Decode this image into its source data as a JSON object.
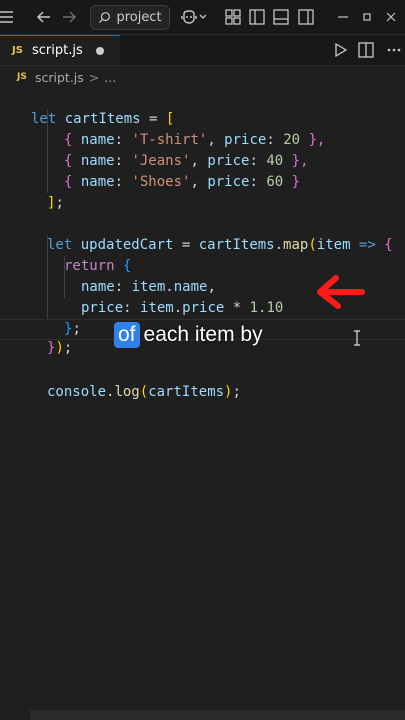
{
  "titlebar": {
    "search_text": "project"
  },
  "tab": {
    "badge": "JS",
    "filename": "script.js"
  },
  "breadcrumb": {
    "badge": "JS",
    "file": "script.js",
    "separator": ">",
    "more": "..."
  },
  "caption": {
    "highlight": "of",
    "rest": "each item by"
  },
  "colors": {
    "accent": "#0078d4",
    "arrow": "#ff1a1a",
    "caption_highlight": "#2f82ea"
  },
  "code": {
    "l1_let": "let",
    "l1_name": "cartItems",
    "l1_eq": " = ",
    "l1_br": "[",
    "items": [
      {
        "open": "{",
        "k1": "name",
        "v1": "'T-shirt'",
        "k2": "price",
        "v2": "20",
        "close": "},"
      },
      {
        "open": "{",
        "k1": "name",
        "v1": "'Jeans'",
        "k2": "price",
        "v2": "40",
        "close": "},"
      },
      {
        "open": "{",
        "k1": "name",
        "v1": "'Shoes'",
        "k2": "price",
        "v2": "60",
        "close": "}"
      }
    ],
    "l5_br": "]",
    "l5_semi": ";",
    "l7_let": "let",
    "l7_name": "updatedCart",
    "l7_eq": " = ",
    "l7_obj": "cartItems",
    "l7_dot": ".",
    "l7_fn": "map",
    "l7_paren": "(",
    "l7_param": "item",
    "l7_arrow": " => ",
    "l7_brace": "{",
    "l8_return": "return",
    "l8_brace": "{",
    "l9_key": "name",
    "l9_colon": ": ",
    "l9_obj": "item",
    "l9_dot": ".",
    "l9_prop": "name",
    "l9_comma": ",",
    "l10_key": "price",
    "l10_colon": ": ",
    "l10_obj": "item",
    "l10_dot": ".",
    "l10_prop": "price",
    "l10_op": " * ",
    "l10_num": "1.10",
    "l11_brace": "}",
    "l11_semi": ";",
    "l12_brace": "}",
    "l12_paren": ")",
    "l12_semi": ";",
    "l14_obj": "console",
    "l14_dot": ".",
    "l14_fn": "log",
    "l14_open": "(",
    "l14_arg": "cartItems",
    "l14_close": ")",
    "l14_semi": ";"
  }
}
